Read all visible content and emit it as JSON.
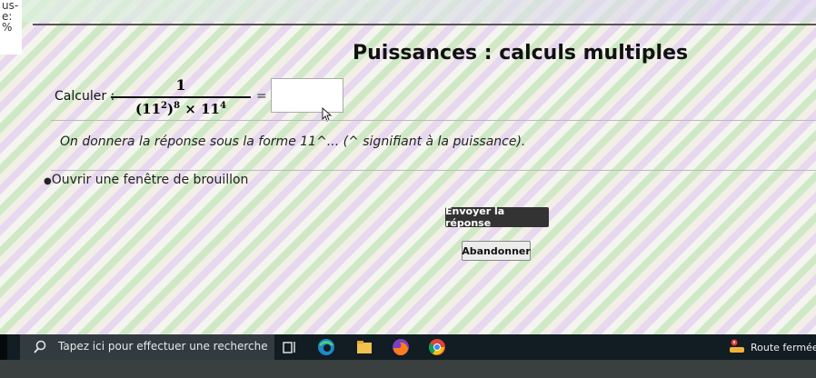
{
  "left_strip": {
    "lines": [
      "us-",
      "e:",
      "%"
    ]
  },
  "page_title": "Puissances : calculs multiples",
  "question": {
    "label": "Calculer :",
    "numerator": "1",
    "equals": "=",
    "answer_value": "",
    "answer_placeholder": ""
  },
  "hint": "On donnera la réponse sous la forme 11^... (^ signifiant à la puissance).",
  "draft_link": {
    "bullet": "●",
    "label": "Ouvrir une fenêtre de brouillon"
  },
  "buttons": {
    "submit": "Envoyer la réponse",
    "cancel": "Abandonner"
  },
  "taskbar": {
    "search_placeholder": "Tapez ici pour effectuer une recherche",
    "icons": [
      "search-icon",
      "task-view-icon",
      "edge-browser-icon",
      "file-explorer-icon",
      "firefox-icon",
      "chrome-icon",
      "weather-alert-icon"
    ],
    "tray_text": "Route fermée c"
  },
  "colors": {
    "taskbar": "#111d22",
    "submit_button": "#333333"
  }
}
